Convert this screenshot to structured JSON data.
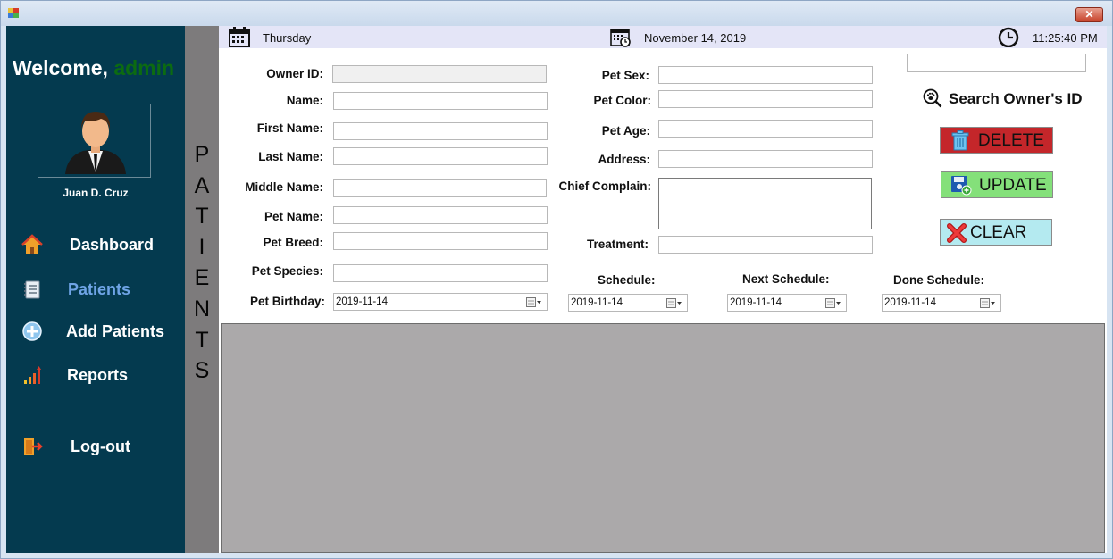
{
  "window": {
    "close_label": "✕"
  },
  "sidebar": {
    "welcome_prefix": "Welcome,",
    "welcome_user": "admin",
    "user_name": "Juan D. Cruz",
    "items": [
      {
        "label": "Dashboard",
        "icon": "house-icon"
      },
      {
        "label": "Patients",
        "icon": "notebook-icon",
        "active": true
      },
      {
        "label": "Add Patients",
        "icon": "plus-circle-icon"
      },
      {
        "label": "Reports",
        "icon": "bar-chart-icon"
      },
      {
        "label": "Log-out",
        "icon": "exit-door-icon"
      }
    ]
  },
  "vertical_title": [
    "P",
    "A",
    "T",
    "I",
    "E",
    "N",
    "T",
    "S"
  ],
  "topbar": {
    "day": "Thursday",
    "date": "November 14, 2019",
    "time": "11:25:40 PM"
  },
  "form": {
    "owner_id": {
      "label": "Owner ID:",
      "value": ""
    },
    "name": {
      "label": "Name:",
      "value": ""
    },
    "first_name": {
      "label": "First Name:",
      "value": ""
    },
    "last_name": {
      "label": "Last Name:",
      "value": ""
    },
    "middle_name": {
      "label": "Middle Name:",
      "value": ""
    },
    "pet_name": {
      "label": "Pet Name:",
      "value": ""
    },
    "pet_breed": {
      "label": "Pet Breed:",
      "value": ""
    },
    "pet_species": {
      "label": "Pet Species:",
      "value": ""
    },
    "pet_birthday": {
      "label": "Pet Birthday:",
      "value": "2019-11-14"
    },
    "pet_sex": {
      "label": "Pet Sex:",
      "value": ""
    },
    "pet_color": {
      "label": "Pet Color:",
      "value": ""
    },
    "pet_age": {
      "label": "Pet Age:",
      "value": ""
    },
    "address": {
      "label": "Address:",
      "value": ""
    },
    "chief_complain": {
      "label": "Chief Complain:",
      "value": ""
    },
    "treatment": {
      "label": "Treatment:",
      "value": ""
    },
    "schedule": {
      "label": "Schedule:",
      "value": "2019-11-14"
    },
    "next_schedule": {
      "label": "Next Schedule:",
      "value": "2019-11-14"
    },
    "done_schedule": {
      "label": "Done Schedule:",
      "value": "2019-11-14"
    }
  },
  "actions": {
    "search_label": "Search Owner's ID",
    "search_value": "",
    "delete_label": "DELETE",
    "update_label": "UPDATE",
    "clear_label": "CLEAR"
  },
  "colors": {
    "sidebar_bg": "#043a4f",
    "active_nav": "#6fa4e6",
    "welcome_user": "#0c6b11",
    "delete_btn": "#c4262a",
    "update_btn": "#84e07a",
    "clear_btn": "#b4eaf0",
    "grid_bg": "#aba9aa"
  }
}
